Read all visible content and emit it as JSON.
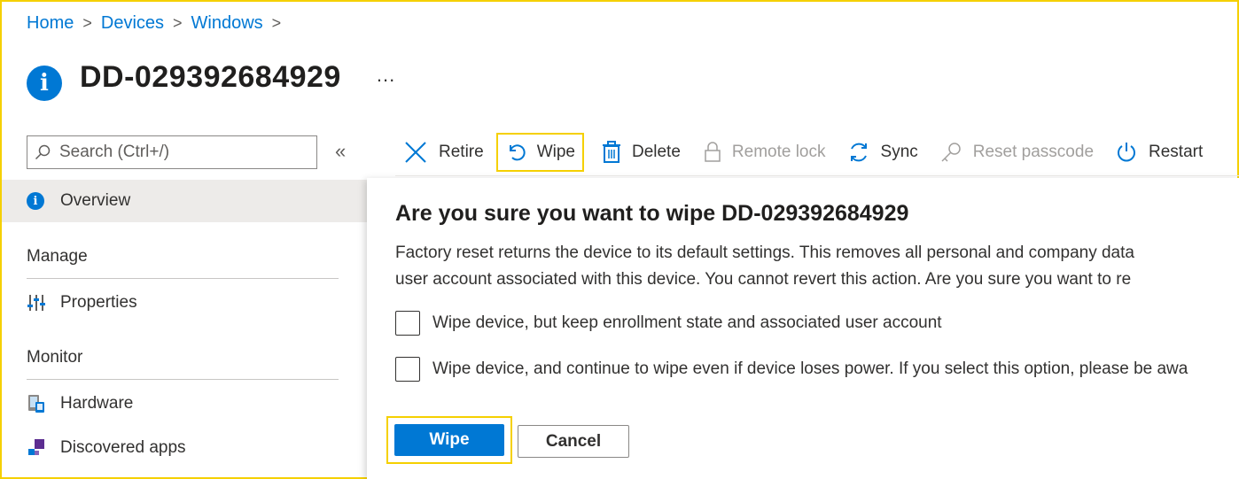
{
  "breadcrumb": {
    "home": "Home",
    "devices": "Devices",
    "windows": "Windows",
    "sep": ">"
  },
  "header": {
    "title": "DD-029392684929",
    "more": "..."
  },
  "sidebar": {
    "search_placeholder": "Search (Ctrl+/)",
    "collapse": "«",
    "overview": "Overview",
    "manage_heading": "Manage",
    "properties": "Properties",
    "monitor_heading": "Monitor",
    "hardware": "Hardware",
    "discovered_apps": "Discovered apps"
  },
  "toolbar": {
    "retire": "Retire",
    "wipe": "Wipe",
    "delete": "Delete",
    "remote_lock": "Remote lock",
    "sync": "Sync",
    "reset_passcode": "Reset passcode",
    "restart": "Restart"
  },
  "dialog": {
    "title": "Are you sure you want to wipe DD-029392684929",
    "desc_line1": "Factory reset returns the device to its default settings. This removes all personal and company data",
    "desc_line2": "user account associated with this device. You cannot revert this action. Are you sure you want to re",
    "option1": "Wipe device, but keep enrollment state and associated user account",
    "option2": "Wipe device, and continue to wipe even if device loses power. If you select this option, please be awa",
    "confirm": "Wipe",
    "cancel": "Cancel"
  },
  "colors": {
    "accent": "#0078d4",
    "highlight": "#f5d000"
  }
}
